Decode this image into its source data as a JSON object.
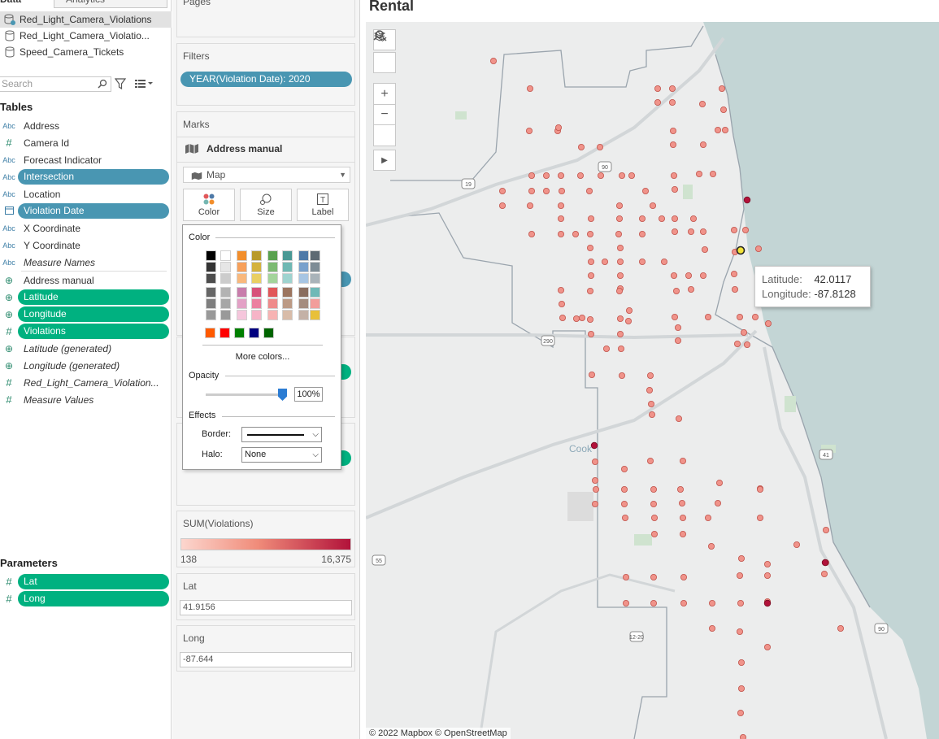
{
  "data_pane": {
    "tab_data": "Data",
    "tab_analytics": "Analytics",
    "datasources": [
      {
        "label": "Red_Light_Camera_Violations",
        "selected": true
      },
      {
        "label": "Red_Light_Camera_Violatio...",
        "selected": false
      },
      {
        "label": "Speed_Camera_Tickets",
        "selected": false
      }
    ],
    "search_placeholder": "Search",
    "tables_title": "Tables",
    "fields": [
      {
        "type": "Abc",
        "label": "Address",
        "style": "plain"
      },
      {
        "type": "#",
        "label": "Camera Id",
        "style": "plain"
      },
      {
        "type": "Abc",
        "label": "Forecast Indicator",
        "style": "plain"
      },
      {
        "type": "Abc",
        "label": "Intersection",
        "style": "pill-blue"
      },
      {
        "type": "Abc",
        "label": "Location",
        "style": "plain"
      },
      {
        "type": "date",
        "label": "Violation Date",
        "style": "pill-blue"
      },
      {
        "type": "Abc",
        "label": "X Coordinate",
        "style": "plain"
      },
      {
        "type": "Abc",
        "label": "Y Coordinate",
        "style": "plain"
      },
      {
        "type": "Abc",
        "label": "Measure Names",
        "style": "italic"
      },
      {
        "type": "divider"
      },
      {
        "type": "globe",
        "label": "Address manual",
        "style": "plain"
      },
      {
        "type": "globe",
        "label": "Latitude",
        "style": "pill-green"
      },
      {
        "type": "globe",
        "label": "Longitude",
        "style": "pill-green"
      },
      {
        "type": "#",
        "label": "Violations",
        "style": "pill-green"
      },
      {
        "type": "globe",
        "label": "Latitude (generated)",
        "style": "italic"
      },
      {
        "type": "globe",
        "label": "Longitude (generated)",
        "style": "italic"
      },
      {
        "type": "#",
        "label": "Red_Light_Camera_Violation...",
        "style": "italic"
      },
      {
        "type": "#",
        "label": "Measure Values",
        "style": "italic"
      }
    ],
    "parameters_title": "Parameters",
    "parameters": [
      {
        "type": "#",
        "label": "Lat"
      },
      {
        "type": "#",
        "label": "Long"
      }
    ]
  },
  "cards": {
    "pages_title": "Pages",
    "filters_title": "Filters",
    "filter_pill": "YEAR(Violation Date): 2020",
    "marks_title": "Marks",
    "marks_layer": "Address manual",
    "mark_type": "Map",
    "mark_buttons": {
      "color": "Color",
      "size": "Size",
      "label": "Label"
    },
    "legend_title": "SUM(Violations)",
    "legend_min": "138",
    "legend_max": "16,375",
    "lat_title": "Lat",
    "lat_value": "41.9156",
    "long_title": "Long",
    "long_value": "-87.644"
  },
  "color_popup": {
    "color_label": "Color",
    "more_colors": "More colors...",
    "opacity_label": "Opacity",
    "opacity_value": "100%",
    "opacity_fraction": 1.0,
    "effects_label": "Effects",
    "border_label": "Border:",
    "halo_label": "Halo:",
    "halo_value": "None"
  },
  "sheet": {
    "title": "Rental"
  },
  "map": {
    "attribution": "© 2022 Mapbox © OpenStreetMap",
    "place_label": "Cook",
    "tooltip": {
      "lat_label": "Latitude:",
      "lat_value": "42.0117",
      "lon_label": "Longitude:",
      "lon_value": "-87.8128"
    },
    "mark_color": "#f0938a",
    "mark_dark_color": "#b2123a",
    "water_color": "#c1d3d3",
    "highway_shields": [
      "19",
      "90",
      "290",
      "55",
      "41",
      "90",
      "12-20"
    ]
  }
}
